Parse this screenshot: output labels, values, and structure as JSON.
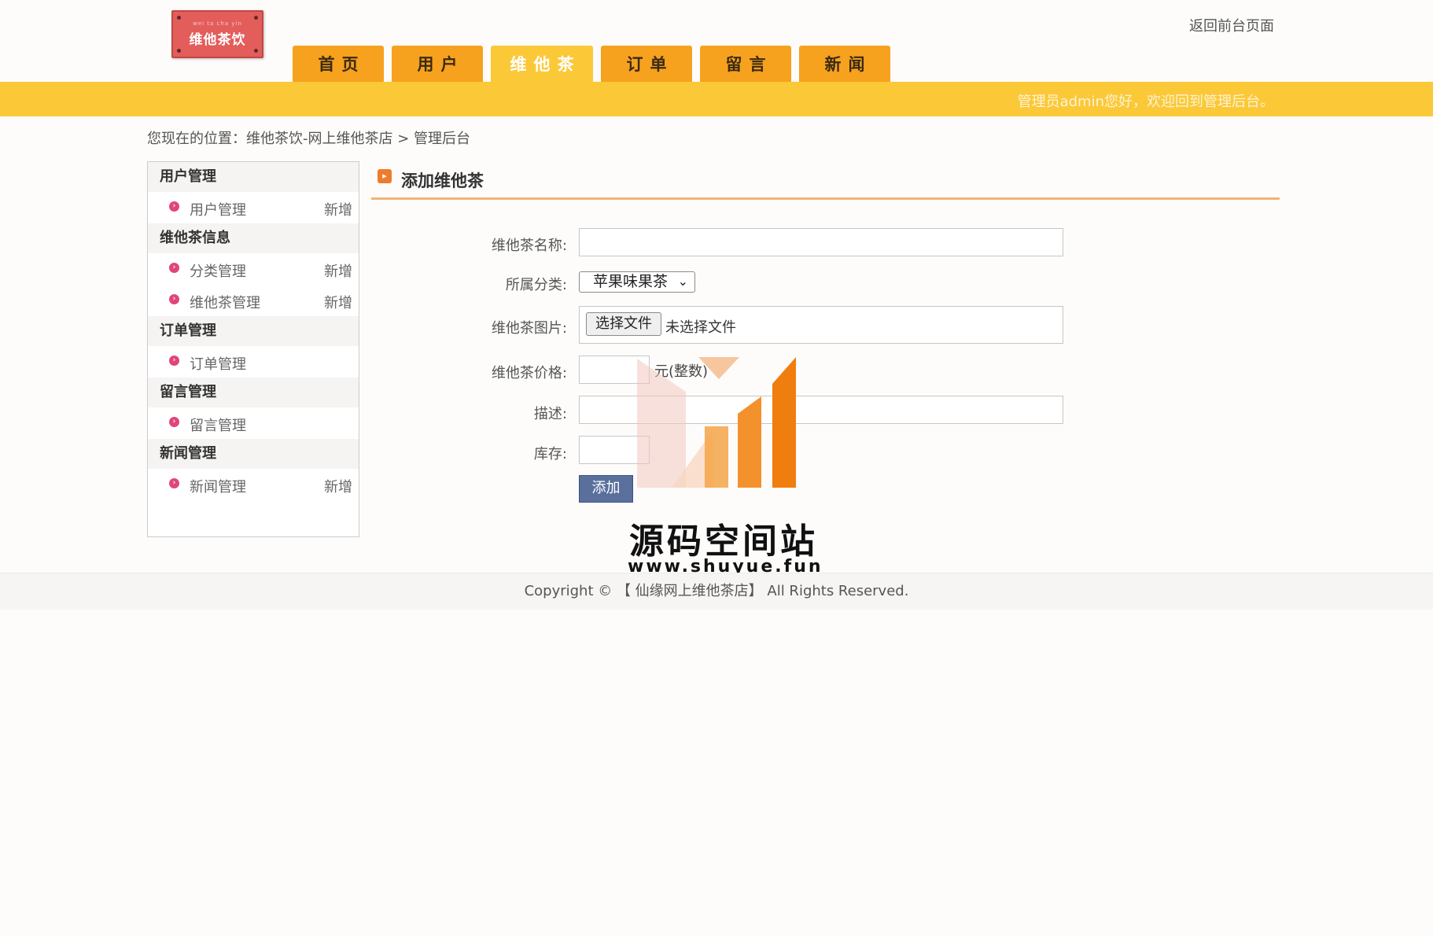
{
  "header": {
    "logo_text": "维他茶饮",
    "logo_subtext": "wei ta cha yin",
    "top_link": "返回前台页面",
    "nav_tabs": [
      {
        "label": "首页",
        "active": false
      },
      {
        "label": "用户",
        "active": false
      },
      {
        "label": "维他茶",
        "active": true
      },
      {
        "label": "订单",
        "active": false
      },
      {
        "label": "留言",
        "active": false
      },
      {
        "label": "新闻",
        "active": false
      }
    ],
    "welcome": "管理员admin您好，欢迎回到管理后台。"
  },
  "breadcrumb": "您现在的位置：维他茶饮-网上维他茶店 > 管理后台",
  "sidebar": {
    "groups": [
      {
        "title": "用户管理",
        "items": [
          {
            "label": "用户管理",
            "add": "新增"
          }
        ]
      },
      {
        "title": "维他茶信息",
        "items": [
          {
            "label": "分类管理",
            "add": "新增"
          },
          {
            "label": "维他茶管理",
            "add": "新增"
          }
        ]
      },
      {
        "title": "订单管理",
        "items": [
          {
            "label": "订单管理",
            "add": ""
          }
        ]
      },
      {
        "title": "留言管理",
        "items": [
          {
            "label": "留言管理",
            "add": ""
          }
        ]
      },
      {
        "title": "新闻管理",
        "items": [
          {
            "label": "新闻管理",
            "add": "新增"
          }
        ]
      }
    ]
  },
  "form": {
    "title": "添加维他茶",
    "name_label": "维他茶名称:",
    "name_value": "",
    "category_label": "所属分类:",
    "category_selected": "苹果味果茶",
    "image_label": "维他茶图片:",
    "file_button": "选择文件",
    "file_status": "未选择文件",
    "price_label": "维他茶价格:",
    "price_value": "",
    "price_unit": "元(整数)",
    "desc_label": "描述:",
    "desc_value": "",
    "stock_label": "库存:",
    "stock_value": "",
    "submit_label": "添加"
  },
  "watermark": {
    "title": "源码空间站",
    "url": "www.shuyue.fun"
  },
  "footer": "Copyright © 【 仙缘网上维他茶店】 All Rights Reserved.",
  "colors": {
    "nav_orange": "#f6a21e",
    "banner_yellow": "#fbc837",
    "button_blue": "#5a6f9c",
    "bullet_pink": "#e1457a"
  }
}
